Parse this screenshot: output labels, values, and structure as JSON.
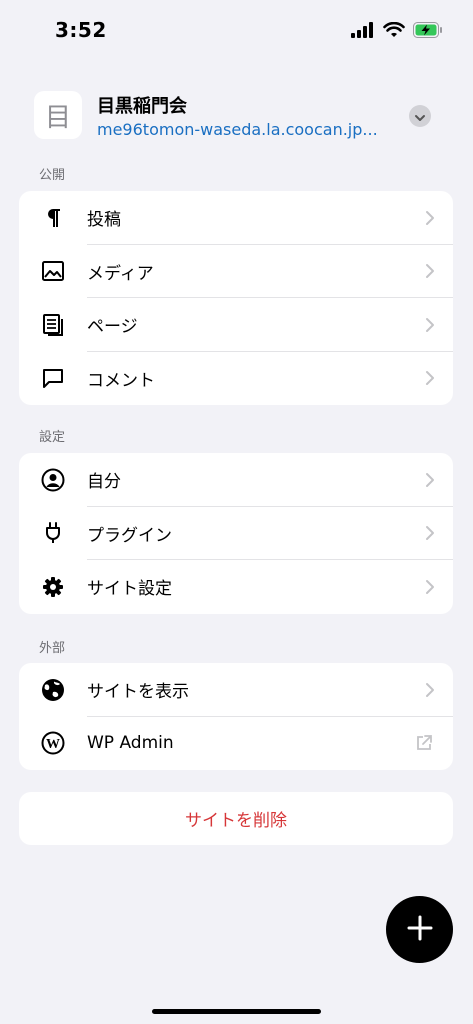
{
  "status_bar": {
    "time": "3:52",
    "battery_color": "#34c759"
  },
  "site": {
    "icon_glyph": "目",
    "name": "目黒稲門会",
    "url": "me96tomon-waseda.la.coocan.jp..."
  },
  "sections": [
    {
      "label": "公開",
      "items": [
        {
          "icon": "paragraph-icon",
          "label": "投稿"
        },
        {
          "icon": "media-icon",
          "label": "メディア"
        },
        {
          "icon": "pages-icon",
          "label": "ページ"
        },
        {
          "icon": "comment-icon",
          "label": "コメント"
        }
      ]
    },
    {
      "label": "設定",
      "items": [
        {
          "icon": "user-icon",
          "label": "自分"
        },
        {
          "icon": "plug-icon",
          "label": "プラグイン"
        },
        {
          "icon": "gear-icon",
          "label": "サイト設定"
        }
      ]
    },
    {
      "label": "外部",
      "items": [
        {
          "icon": "globe-icon",
          "label": "サイトを表示"
        },
        {
          "icon": "wordpress-icon",
          "label": "WP Admin"
        }
      ]
    }
  ],
  "delete_site": {
    "label": "サイトを削除",
    "color": "#d63638"
  },
  "fab": {
    "icon": "plus-icon"
  },
  "colors": {
    "link": "#1a6fc2",
    "background": "#f2f2f7"
  }
}
